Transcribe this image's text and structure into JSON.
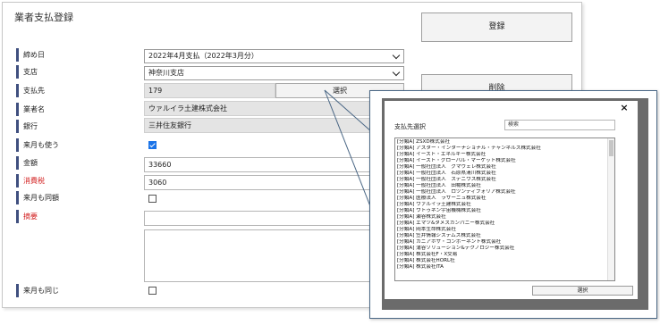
{
  "page": {
    "title": "業者支払登録"
  },
  "form": {
    "labels": {
      "shime": "締め日",
      "shiten": "支店",
      "shiharaisaki": "支払先",
      "gyoshamei": "業者名",
      "ginko": "銀行",
      "raigetsu": "来月も使う",
      "kingaku": "金額",
      "shohizei": "消費税",
      "raigetsu_dogaku": "来月も同額",
      "tekiyo": "摘要",
      "raigetsu_onaji": "来月も同じ"
    },
    "shime_value": "2022年4月支払（2022年3月分）",
    "shiten_value": "神奈川支店",
    "shiharaisaki_value": "179",
    "select_label": "選択",
    "gyoshamei_value": "ウァルイラ土建株式会社",
    "ginko_value": "三井住友銀行",
    "raigetsu_checked": true,
    "kingaku_value": "33660",
    "shohizei_value": "3060",
    "raigetsu_dogaku_checked": false,
    "raigetsu_onaji_checked": false
  },
  "buttons": {
    "register": "登録",
    "delete": "削除"
  },
  "dialog": {
    "close": "×",
    "label": "支払先選択",
    "search_placeholder": "検索",
    "select_button": "選択",
    "items": [
      "[分類A] ZSXD株式会社",
      "[分類A] アスター・インターナショナル・チャンネルズ株式会社",
      "[分類A] イースト・エネルギー株式会社",
      "[分類A] イースト・グローバル・マーケット株式会社",
      "[分類A] 一般社団法人　グマヴェレ株式会社",
      "[分類A] 一般社団法人　石原県清川株式会社",
      "[分類A] 一般社団法人　ステニウス株式会社",
      "[分類A] 一般社団法人　田楊株式会社",
      "[分類A] 一般社団法人　ロツンディフォリア株式会社",
      "[分類A] 医療法人　ラサーニュ株式会社",
      "[分類A] ウァルイラ土建株式会社",
      "[分類A] ウトゥネン宇宙機械株式会社",
      "[分類A] 瀬谷株式会社",
      "[分類A] エマツ&タメスカンパニー株式会社",
      "[分類A] 岡本生命株式会社",
      "[分類A] 笠井情報システムズ株式会社",
      "[分類A] カニアホザ・コンポーネント株式会社",
      "[分類A] 蒲谷ソリューション&テクノロジー株式会社",
      "[分類A] 株式会社F・X交易",
      "[分類A] 株式会社HORL社",
      "[分類A] 株式会社ITA"
    ]
  }
}
